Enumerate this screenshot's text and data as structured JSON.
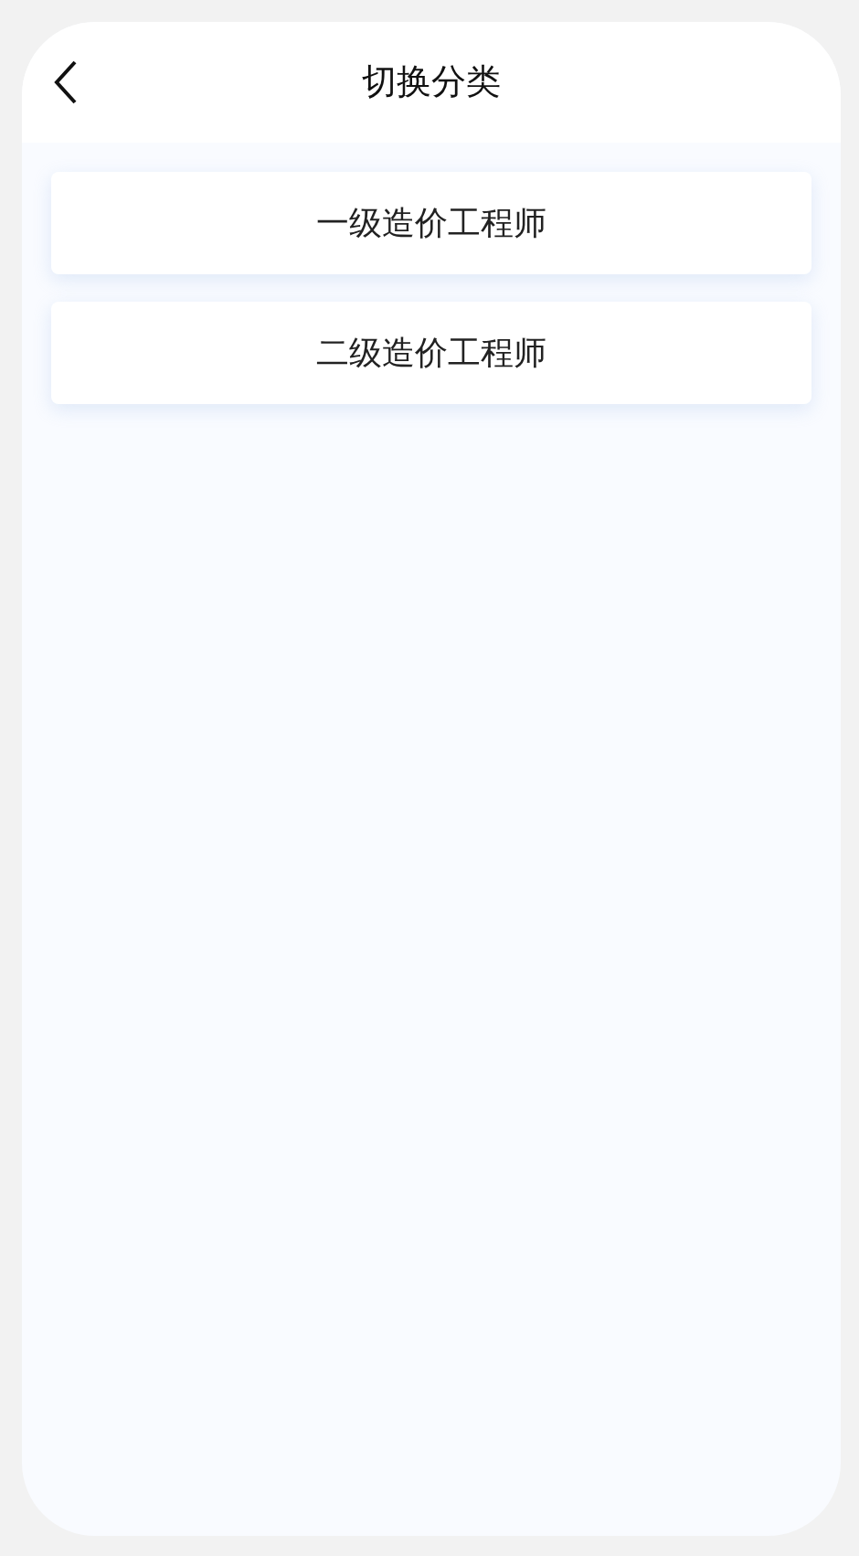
{
  "header": {
    "title": "切换分类"
  },
  "categories": [
    {
      "label": "一级造价工程师"
    },
    {
      "label": "二级造价工程师"
    }
  ]
}
